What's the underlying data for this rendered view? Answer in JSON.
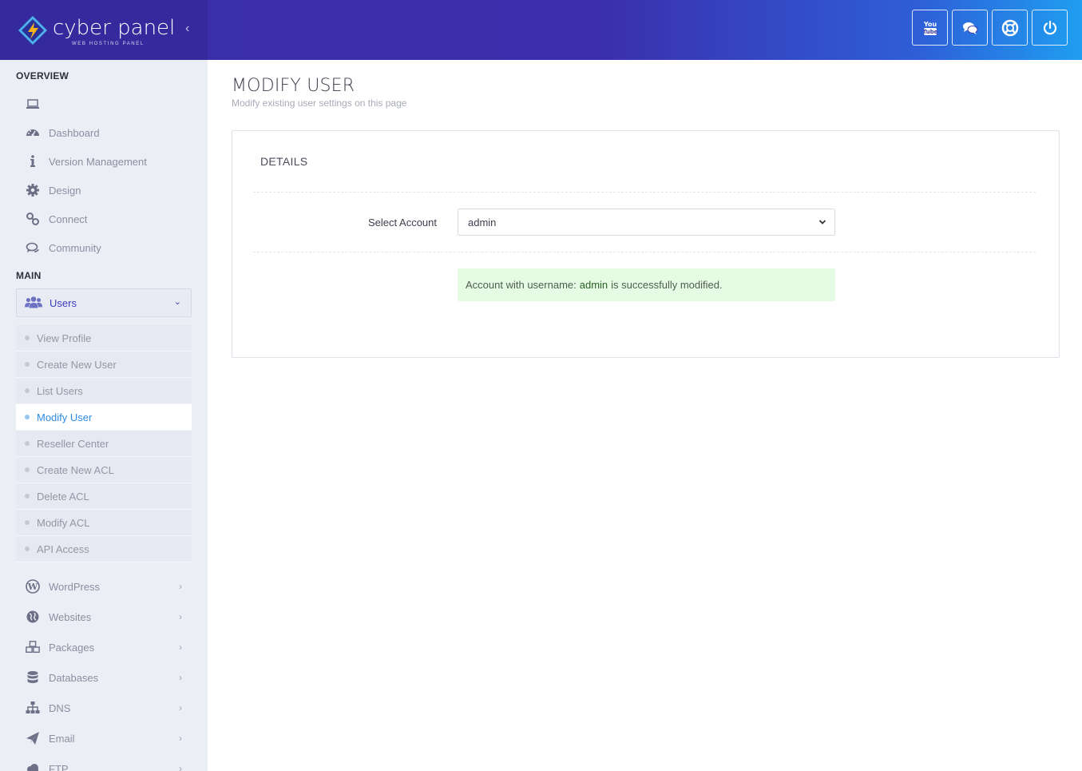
{
  "brand": {
    "name": "cyber panel",
    "tagline": "WEB HOSTING PANEL",
    "collapse_glyph": "‹"
  },
  "header_buttons": [
    {
      "name": "youtube-icon",
      "label": "YouTube"
    },
    {
      "name": "chat-icon",
      "label": "Community chat"
    },
    {
      "name": "lifebuoy-icon",
      "label": "Support"
    },
    {
      "name": "power-icon",
      "label": "Logout"
    }
  ],
  "sidebar": {
    "overview_title": "OVERVIEW",
    "overview_items": [
      {
        "label": "",
        "icon": "laptop-icon"
      },
      {
        "label": "Dashboard",
        "icon": "dashboard-icon"
      },
      {
        "label": "Version Management",
        "icon": "info-icon"
      },
      {
        "label": "Design",
        "icon": "gear-icon"
      },
      {
        "label": "Connect",
        "icon": "link-icon"
      },
      {
        "label": "Community",
        "icon": "comments-icon"
      }
    ],
    "main_title": "MAIN",
    "users_group": {
      "label": "Users",
      "icon": "users-icon",
      "chevron": "⌄"
    },
    "users_sub": [
      {
        "label": "View Profile",
        "active": false
      },
      {
        "label": "Create New User",
        "active": false
      },
      {
        "label": "List Users",
        "active": false
      },
      {
        "label": "Modify User",
        "active": true
      },
      {
        "label": "Reseller Center",
        "active": false
      },
      {
        "label": "Create New ACL",
        "active": false
      },
      {
        "label": "Delete ACL",
        "active": false
      },
      {
        "label": "Modify ACL",
        "active": false
      },
      {
        "label": "API Access",
        "active": false
      }
    ],
    "main_items": [
      {
        "label": "WordPress",
        "icon": "wordpress-icon"
      },
      {
        "label": "Websites",
        "icon": "globe-icon"
      },
      {
        "label": "Packages",
        "icon": "cubes-icon"
      },
      {
        "label": "Databases",
        "icon": "database-icon"
      },
      {
        "label": "DNS",
        "icon": "sitemap-icon"
      },
      {
        "label": "Email",
        "icon": "paper-plane-icon"
      },
      {
        "label": "FTP",
        "icon": "cloud-icon"
      }
    ],
    "arrow_glyph": "›"
  },
  "page": {
    "title": "MODIFY USER",
    "subtitle": "Modify existing user settings on this page",
    "card_title": "DETAILS",
    "select_label": "Select Account",
    "select_value": "admin",
    "alert_prefix": "Account with username:",
    "alert_user": "admin",
    "alert_suffix": "is successfully modified."
  },
  "colors": {
    "accent": "#3a3ec0",
    "active_link": "#2f8ae0",
    "success_bg": "#e6fbe3",
    "header_start": "#3a2fa8",
    "header_end": "#1f9ef0"
  }
}
